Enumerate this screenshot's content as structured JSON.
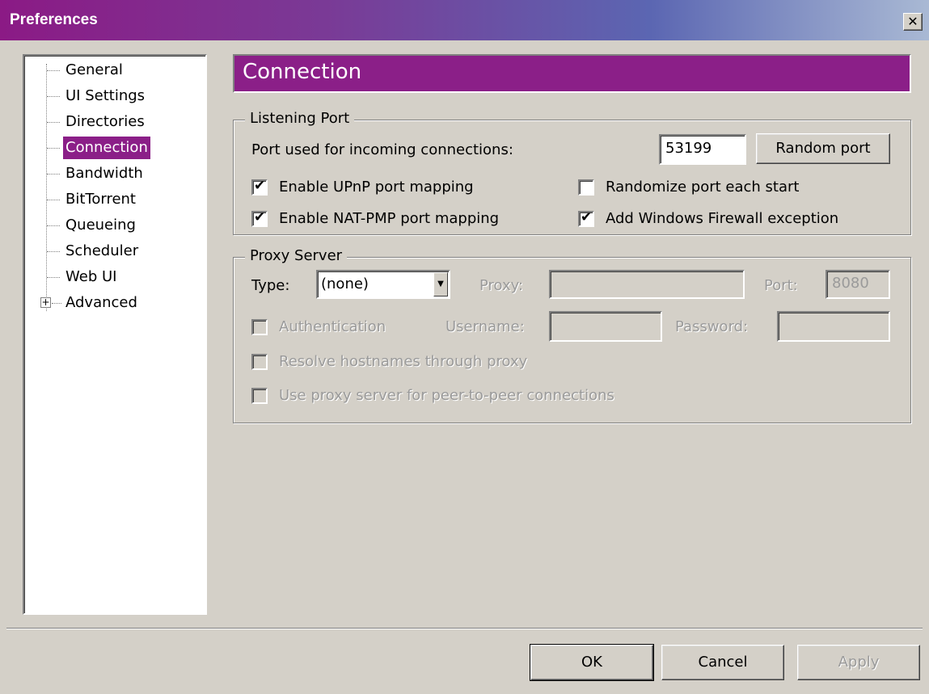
{
  "window": {
    "title": "Preferences",
    "close_glyph": "✕"
  },
  "tree": {
    "items": [
      {
        "label": "General"
      },
      {
        "label": "UI Settings"
      },
      {
        "label": "Directories"
      },
      {
        "label": "Connection",
        "selected": true
      },
      {
        "label": "Bandwidth"
      },
      {
        "label": "BitTorrent"
      },
      {
        "label": "Queueing"
      },
      {
        "label": "Scheduler"
      },
      {
        "label": "Web UI"
      },
      {
        "label": "Advanced",
        "expander": "+"
      }
    ]
  },
  "header": {
    "title": "Connection"
  },
  "listening": {
    "legend": "Listening Port",
    "port_label": "Port used for incoming connections:",
    "port_value": "53199",
    "random_button": "Random port",
    "upnp": {
      "label": "Enable UPnP port mapping",
      "checked": true
    },
    "natpmp": {
      "label": "Enable NAT-PMP port mapping",
      "checked": true
    },
    "randomize": {
      "label": "Randomize port each start",
      "checked": false
    },
    "firewall": {
      "label": "Add Windows Firewall exception",
      "checked": true
    }
  },
  "proxy": {
    "legend": "Proxy Server",
    "type_label": "Type:",
    "type_value": "(none)",
    "proxy_label": "Proxy:",
    "proxy_value": "",
    "port_label": "Port:",
    "port_value": "8080",
    "auth": {
      "label": "Authentication",
      "checked": false
    },
    "username_label": "Username:",
    "password_label": "Password:",
    "resolve": {
      "label": "Resolve hostnames through proxy",
      "checked": false
    },
    "p2p": {
      "label": "Use proxy server for peer-to-peer connections",
      "checked": false
    }
  },
  "buttons": {
    "ok": "OK",
    "cancel": "Cancel",
    "apply": "Apply"
  },
  "colors": {
    "accent": "#8b1f88",
    "face": "#d4d0c8"
  },
  "icons": {
    "check": "✔",
    "dropdown": "▼"
  }
}
